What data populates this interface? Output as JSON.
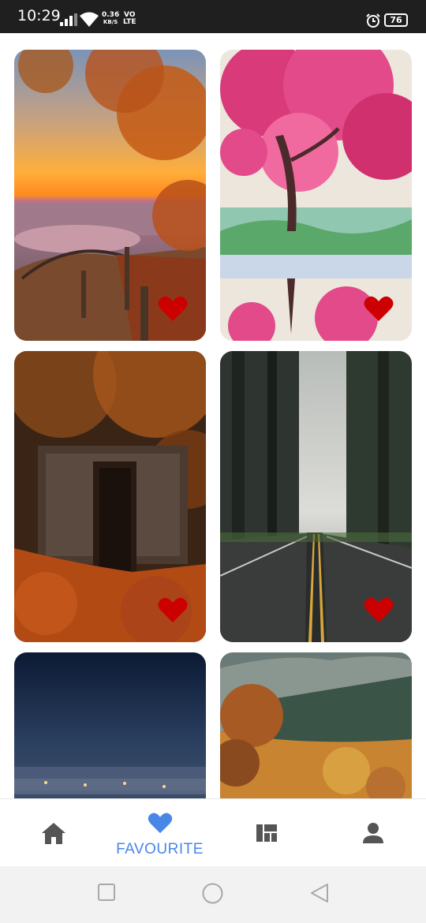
{
  "status_bar": {
    "time": "10:29",
    "speed_value": "0.36",
    "speed_unit": "KB/S",
    "net_top": "VO",
    "net_bottom": "LTE",
    "battery": "76"
  },
  "wallpapers": [
    {
      "label": "Autumn sunset overlook",
      "favourited": true
    },
    {
      "label": "Pink blossom tree painting",
      "favourited": true
    },
    {
      "label": "Stone door in autumn forest",
      "favourited": true
    },
    {
      "label": "Misty forest road",
      "favourited": true
    },
    {
      "label": "Night city lights",
      "favourited": false
    },
    {
      "label": "Autumn mountain forest",
      "favourited": false
    }
  ],
  "bottom_nav": {
    "active": "favourite",
    "favourite_label": "FAVOURITE",
    "accent": "#4a86e8",
    "inactive_color": "#555555"
  },
  "heart_color": "#cc0000"
}
